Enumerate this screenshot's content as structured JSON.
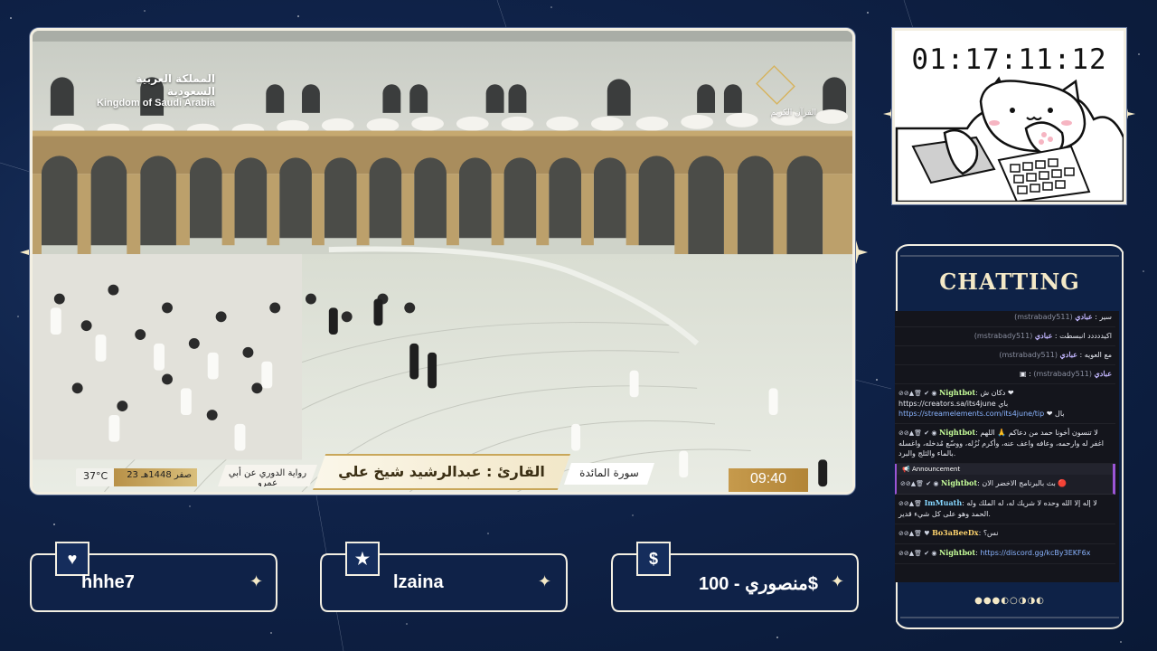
{
  "broadcast": {
    "channel_ar": "المملكة العربية السعودية",
    "channel_en": "Kingdom of Saudi Arabia",
    "network_label": "القرآن الكريم",
    "temperature": "37°C",
    "hijri_date": "23 صفر 1448هـ",
    "riwaya": "رواية الدوري عن أبي عمرو",
    "reciter": "القارئ : عبدالرشيد شيخ علي",
    "surah": "سورة المائدة",
    "clock": "09:40"
  },
  "timer": {
    "value": "01:17:11:12"
  },
  "chat": {
    "title": "CHATTING",
    "messages": [
      {
        "user": "عبادي",
        "handle": "(mstrabady511)",
        "text": "سير",
        "color": "#c3b7ff"
      },
      {
        "user": "عبادي",
        "handle": "(mstrabady511)",
        "text": "اكيددددد انبسطت",
        "color": "#c3b7ff"
      },
      {
        "user": "عبادي",
        "handle": "(mstrabady511)",
        "text": "مع العويه",
        "color": "#c3b7ff"
      },
      {
        "user": "عبادي",
        "handle": "(mstrabady511)",
        "text": "",
        "color": "#c3b7ff"
      },
      {
        "user": "Nightbot",
        "text": "دكان ش ❤ https://creators.sa/its4june باي",
        "link2": "https://streamelements.com/its4june/tip",
        "text2": "❤ بال",
        "color": "#c7ff9a"
      },
      {
        "user": "Nightbot",
        "text": "لا تنسون أخونا حمد من دعاكم 🙏 اللهم اغفر له وارحمه، وعافه واعف عنه، وأكرم نُزُله، ووسّع مُدخله، واغسله بالماء والثلج والبرد.",
        "color": "#c7ff9a"
      }
    ],
    "announcement_label": "Announcement",
    "announcement": {
      "user": "Nightbot",
      "text": "بث بالبرنامج الاخضر الان 🔴",
      "color": "#c7ff9a"
    },
    "after": [
      {
        "user": "ImMuath",
        "text": "لا إله إلا الله وحده لا شريك له، له الملك وله الحمد وهو على كل شيء قدير.",
        "color": "#86d7ff"
      },
      {
        "user": "Bo3aBeeDx",
        "text": "نس؟",
        "color": "#ffd46e"
      },
      {
        "user": "Nightbot",
        "link": "https://discord.gg/kcBy3EKF6x",
        "color": "#c7ff9a"
      }
    ],
    "moon_phases": "●●●◐○◑◑◐"
  },
  "cards": [
    {
      "icon": "heart-icon",
      "glyph": "♥",
      "label": "hhhe7"
    },
    {
      "icon": "star-icon",
      "glyph": "★",
      "label": "lzaina"
    },
    {
      "icon": "dollar-icon",
      "glyph": "$",
      "label": "منصوري - 100$"
    }
  ]
}
